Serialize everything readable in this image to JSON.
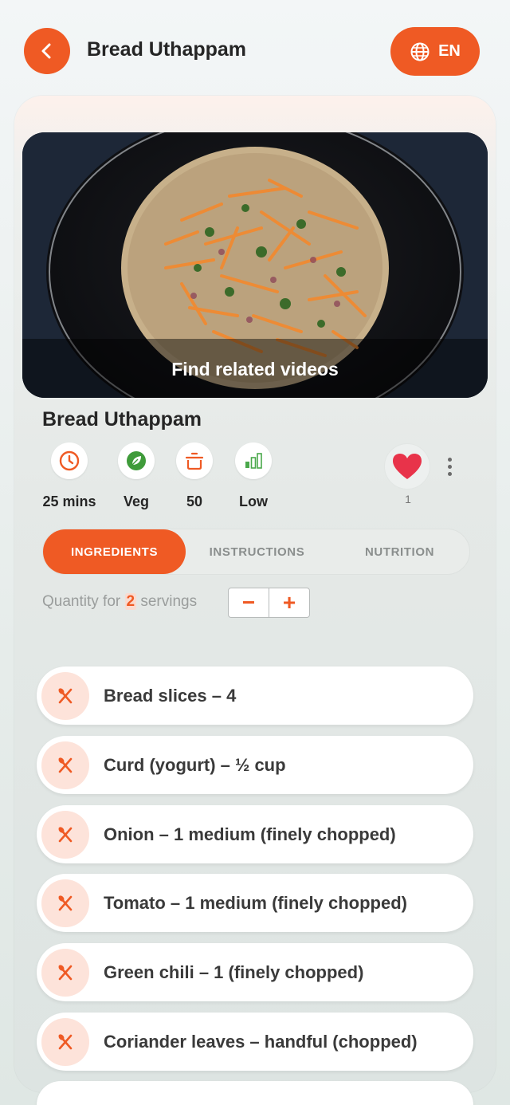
{
  "header": {
    "title": "Bread Uthappam",
    "language": "EN"
  },
  "hero": {
    "caption": "Find related videos"
  },
  "recipe": {
    "name": "Bread Uthappam",
    "stats": [
      {
        "icon": "clock-icon",
        "label": "25 mins"
      },
      {
        "icon": "leaf-icon",
        "label": "Veg"
      },
      {
        "icon": "pot-icon",
        "label": "50"
      },
      {
        "icon": "signal-bars-icon",
        "label": "Low"
      }
    ],
    "favorites": "1"
  },
  "tabs": [
    {
      "label": "INGREDIENTS",
      "active": true
    },
    {
      "label": "INSTRUCTIONS",
      "active": false
    },
    {
      "label": "NUTRITION",
      "active": false
    }
  ],
  "quantity": {
    "prefix": "Quantity for",
    "servings": "2",
    "suffix": "servings",
    "minus": "−",
    "plus": "+"
  },
  "ingredients": [
    "Bread slices – 4",
    "Curd (yogurt) – ½ cup",
    "Onion – 1 medium (finely chopped)",
    "Tomato – 1 medium (finely chopped)",
    "Green chili – 1 (finely chopped)",
    "Coriander leaves – handful (chopped)"
  ],
  "colors": {
    "accent": "#ef5a24",
    "accent_light": "#fde3da",
    "heart": "#e8334a"
  }
}
